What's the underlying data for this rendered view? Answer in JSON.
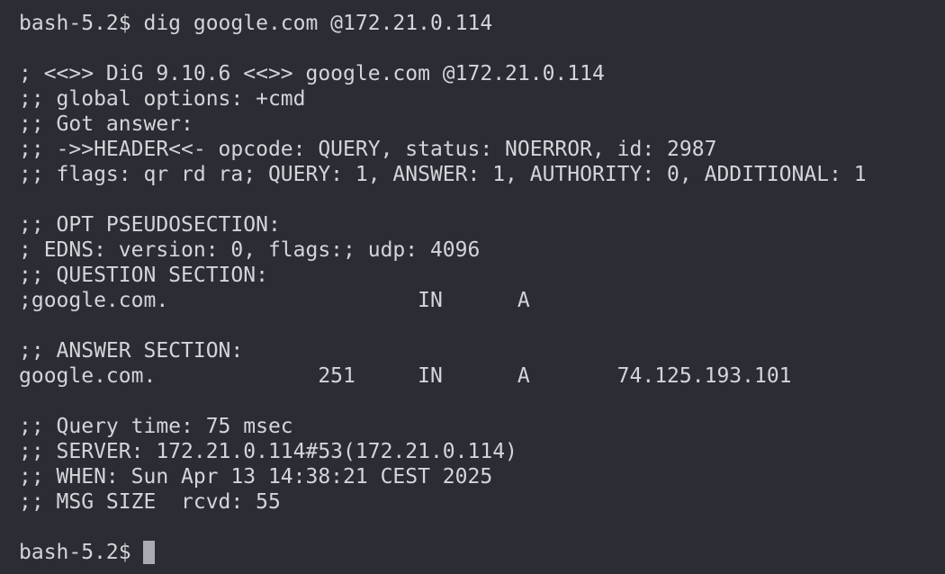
{
  "terminal": {
    "command_line": "bash-5.2$ dig google.com @172.21.0.114",
    "output": {
      "blank_1": "",
      "dig_version": "; <<>> DiG 9.10.6 <<>> google.com @172.21.0.114",
      "global_options": ";; global options: +cmd",
      "got_answer": ";; Got answer:",
      "header": ";; ->>HEADER<<- opcode: QUERY, status: NOERROR, id: 2987",
      "flags": ";; flags: qr rd ra; QUERY: 1, ANSWER: 1, AUTHORITY: 0, ADDITIONAL: 1",
      "blank_2": "",
      "opt_heading": ";; OPT PSEUDOSECTION:",
      "edns": "; EDNS: version: 0, flags:; udp: 4096",
      "question_heading": ";; QUESTION SECTION:",
      "question_record": ";google.com.                    IN      A",
      "blank_3": "",
      "answer_heading": ";; ANSWER SECTION:",
      "answer_record": "google.com.             251     IN      A       74.125.193.101",
      "blank_4": "",
      "query_time": ";; Query time: 75 msec",
      "server": ";; SERVER: 172.21.0.114#53(172.21.0.114)",
      "when": ";; WHEN: Sun Apr 13 14:38:21 CEST 2025",
      "msg_size": ";; MSG SIZE  rcvd: 55",
      "blank_5": ""
    },
    "prompt": "bash-5.2$ "
  }
}
